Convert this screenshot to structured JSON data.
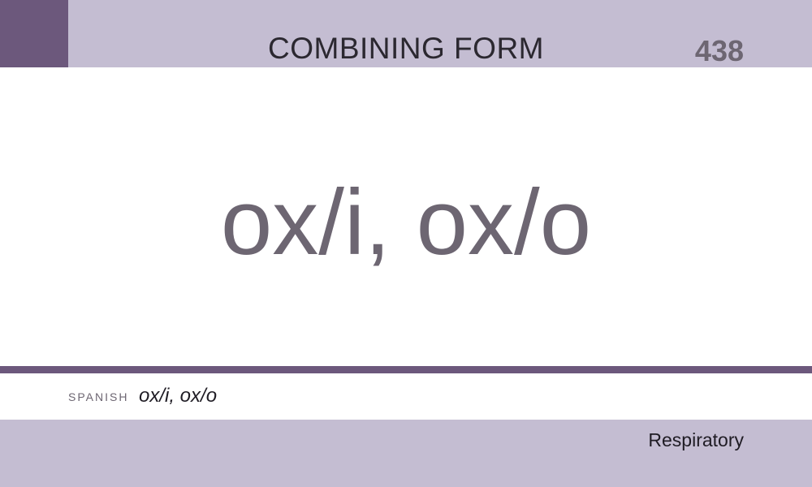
{
  "card": {
    "type_label": "COMBINING FORM",
    "number": "438",
    "term": "ox/i, ox/o",
    "translation_language": "SPANISH",
    "translation": "ox/i, ox/o",
    "category": "Respiratory"
  },
  "colors": {
    "band": "#c4bdd2",
    "accent": "#6c587c",
    "term_text": "#6d6672"
  }
}
